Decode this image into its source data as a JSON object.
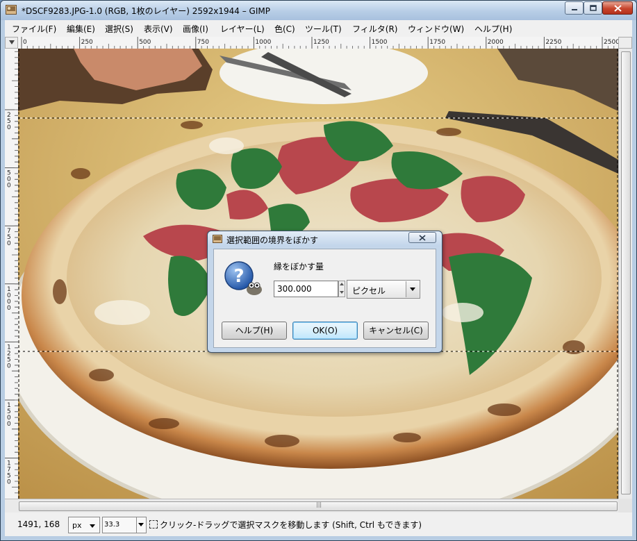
{
  "window": {
    "title": "*DSCF9283.JPG-1.0 (RGB, 1枚のレイヤー) 2592x1944 – GIMP",
    "icon": "gimp-image-icon",
    "controls": [
      "minimize",
      "maximize",
      "close"
    ]
  },
  "menu": [
    "ファイル(F)",
    "編集(E)",
    "選択(S)",
    "表示(V)",
    "画像(I)",
    "レイヤー(L)",
    "色(C)",
    "ツール(T)",
    "フィルタ(R)",
    "ウィンドウ(W)",
    "ヘルプ(H)"
  ],
  "ruler": {
    "horizontal_labels": [
      "0",
      "250",
      "500",
      "750",
      "1000",
      "1250",
      "1500",
      "1750",
      "2000",
      "2250",
      "2500"
    ],
    "vertical_labels": [
      "250",
      "500",
      "750",
      "1000",
      "1250",
      "1500",
      "1750"
    ]
  },
  "canvas": {
    "image": "photo of a pizza topped with prosciutto, arugula and cheese on a white plate",
    "selection": "rectangular marching-ants selection across the middle band of the image"
  },
  "statusbar": {
    "coords": "1491, 168",
    "unit": "px",
    "zoom": "33.3",
    "message": "クリック-ドラッグで選択マスクを移動します (Shift, Ctrl もできます)"
  },
  "dialog": {
    "title": "選択範囲の境界をぼかす",
    "label": "縁をぼかす量",
    "value": "300.000",
    "unit": "ピクセル",
    "buttons": {
      "help": "ヘルプ(H)",
      "ok": "OK(O)",
      "cancel": "キャンセル(C)"
    }
  },
  "colors": {
    "titlebar": "#c4d6ea",
    "ok_button_border": "#3c7fb1",
    "selection": "#000000"
  }
}
